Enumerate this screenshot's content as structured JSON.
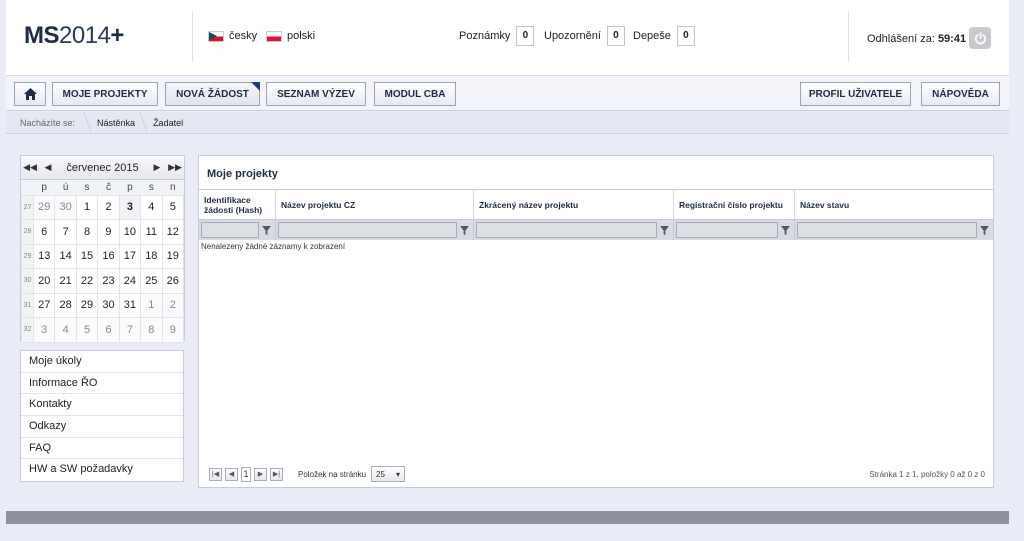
{
  "header": {
    "logo": {
      "ms": "MS",
      "year": "2014",
      "plus": "+"
    },
    "languages": [
      {
        "label": "česky",
        "flag": "cz"
      },
      {
        "label": "polski",
        "flag": "pl"
      }
    ],
    "counters": [
      {
        "label": "Poznámky",
        "value": "0"
      },
      {
        "label": "Upozornění",
        "value": "0"
      },
      {
        "label": "Depeše",
        "value": "0"
      }
    ],
    "logout": {
      "label": "Odhlášení za:",
      "time": "59:41"
    }
  },
  "nav": {
    "home": "home-icon",
    "items": [
      "MOJE PROJEKTY",
      "NOVÁ ŽÁDOST",
      "SEZNAM VÝZEV",
      "MODUL CBA"
    ],
    "right_items": [
      "PROFIL UŽIVATELE",
      "NÁPOVĚDA"
    ]
  },
  "breadcrumb": {
    "label": "Nacházíte se:",
    "items": [
      "Nástěnka",
      "Žadatel"
    ]
  },
  "calendar": {
    "title": "červenec 2015",
    "days": [
      "p",
      "ú",
      "s",
      "č",
      "p",
      "s",
      "n"
    ],
    "weeks": [
      {
        "wk": "27",
        "days": [
          "29",
          "30",
          "1",
          "2",
          "3",
          "4",
          "5"
        ]
      },
      {
        "wk": "28",
        "days": [
          "6",
          "7",
          "8",
          "9",
          "10",
          "11",
          "12"
        ]
      },
      {
        "wk": "29",
        "days": [
          "13",
          "14",
          "15",
          "16",
          "17",
          "18",
          "19"
        ]
      },
      {
        "wk": "30",
        "days": [
          "20",
          "21",
          "22",
          "23",
          "24",
          "25",
          "26"
        ]
      },
      {
        "wk": "31",
        "days": [
          "27",
          "28",
          "29",
          "30",
          "31",
          "1",
          "2"
        ]
      },
      {
        "wk": "32",
        "days": [
          "3",
          "4",
          "5",
          "6",
          "7",
          "8",
          "9"
        ]
      }
    ]
  },
  "side_menu": [
    "Moje úkoly",
    "Informace ŘO",
    "Kontakty",
    "Odkazy",
    "FAQ",
    "HW a SW požadavky"
  ],
  "projects": {
    "title": "Moje projekty",
    "columns": [
      "Identifikace žádosti (Hash)",
      "Název projektu CZ",
      "Zkrácený název projektu",
      "Registrační číslo projektu",
      "Název stavu"
    ],
    "empty_message": "Nenalezeny žádné záznamy k zobrazení",
    "pager": {
      "page": "1",
      "per_page_label": "Položek na stránku",
      "per_page": "25",
      "info": "Stránka 1 z 1, položky 0 až 0 z 0"
    }
  },
  "colors": {
    "accent": "#1a3a8a",
    "footer": "#8d919c"
  }
}
